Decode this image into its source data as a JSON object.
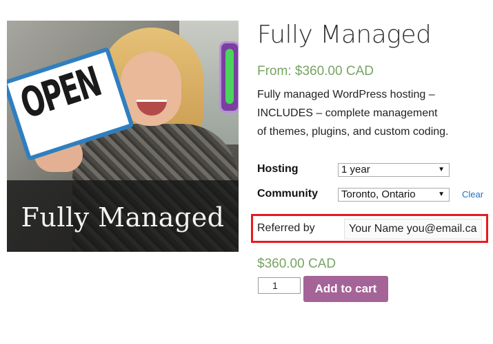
{
  "product": {
    "image_caption": "Fully Managed",
    "image_sign_text": "OPEN",
    "title": "Fully Managed",
    "price_from": "From: $360.00 CAD",
    "description_lines": [
      "Fully managed WordPress hosting –",
      "INCLUDES – complete management",
      "of themes, plugins, and custom coding."
    ]
  },
  "variations": [
    {
      "label": "Hosting",
      "selected": "1 year"
    },
    {
      "label": "Community",
      "selected": "Toronto, Ontario"
    }
  ],
  "clear_label": "Clear",
  "referred": {
    "label": "Referred by",
    "value": "Your Name you@email.ca"
  },
  "price_final": "$360.00 CAD",
  "quantity": "1",
  "add_to_cart_label": "Add to cart",
  "colors": {
    "price": "#77a464",
    "add_to_cart_bg": "#a46497",
    "highlight_border": "#e8191f",
    "link": "#1e6fc0"
  }
}
